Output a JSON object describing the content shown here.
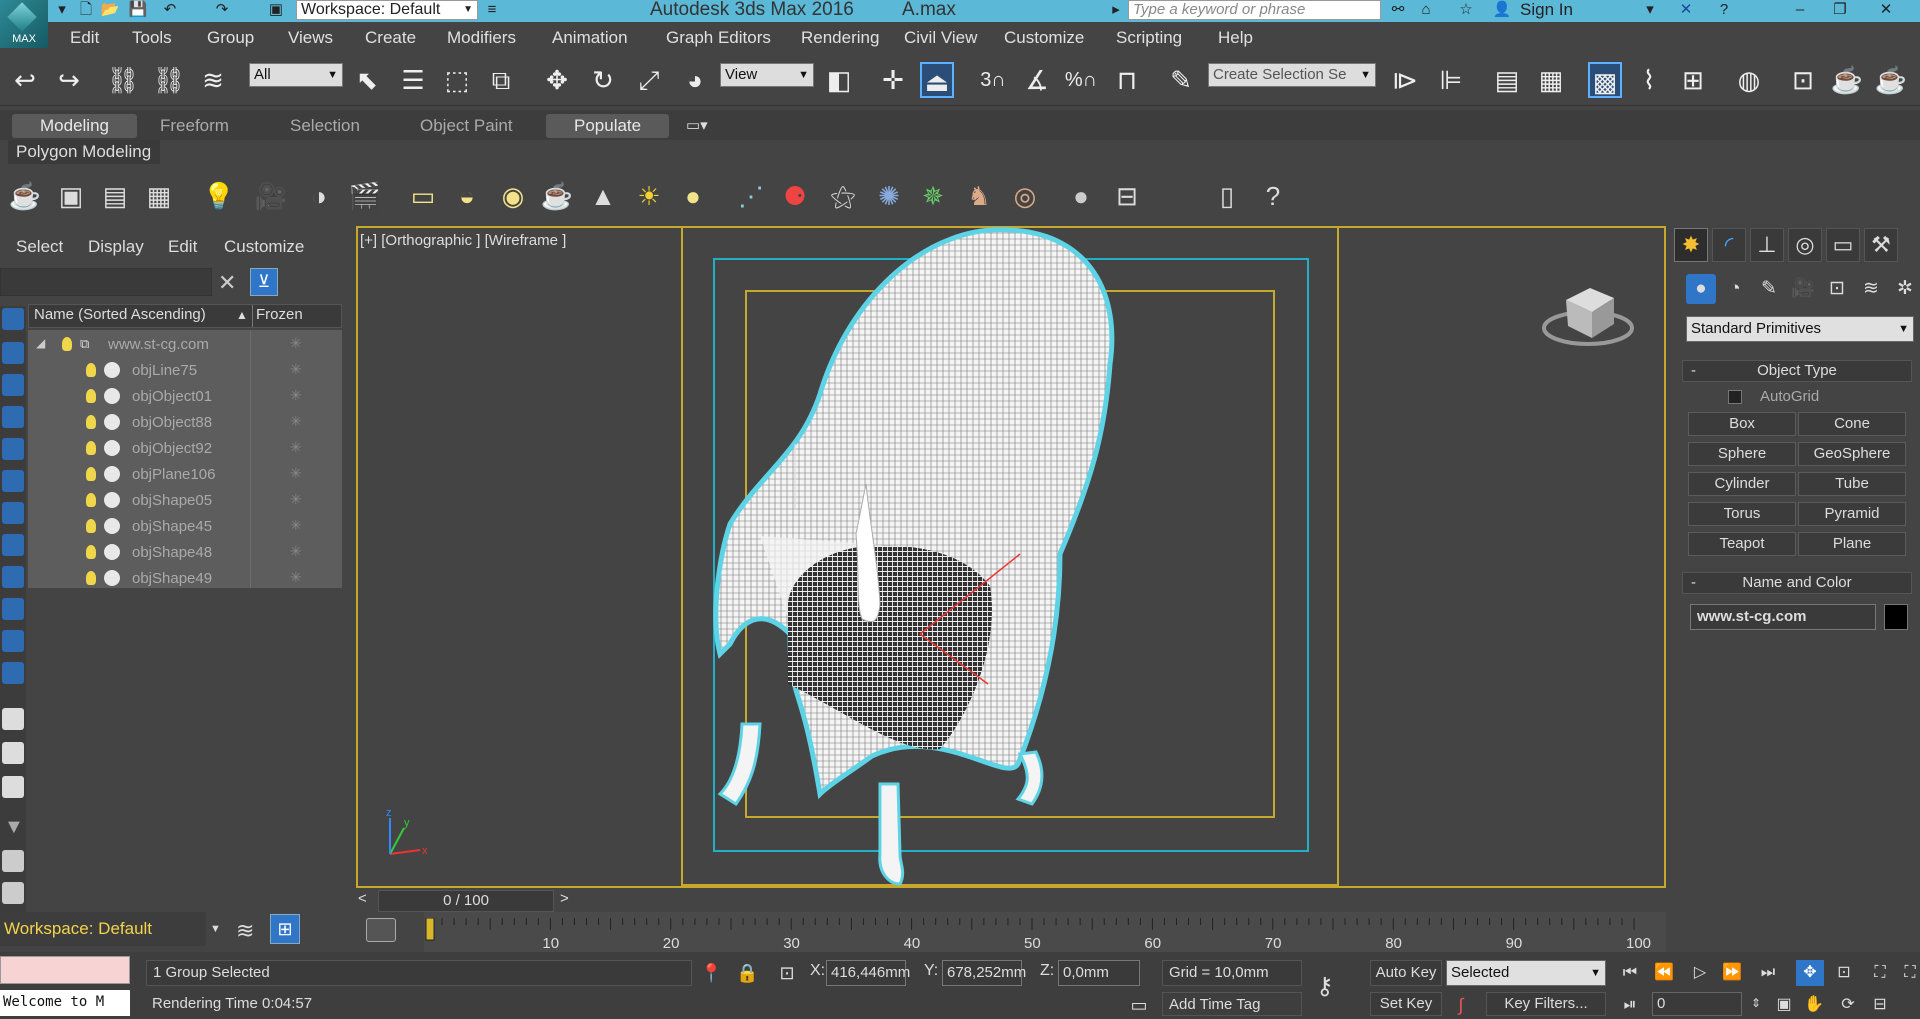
{
  "titlebar": {
    "workspace": "Workspace: Default",
    "app_title": "Autodesk 3ds Max 2016",
    "file_title": "A.max",
    "search_placeholder": "Type a keyword or phrase",
    "sign_in": "Sign In",
    "logo_label": "MAX"
  },
  "menu": [
    "Edit",
    "Tools",
    "Group",
    "Views",
    "Create",
    "Modifiers",
    "Animation",
    "Graph Editors",
    "Rendering",
    "Civil View",
    "Customize",
    "Scripting",
    "Help"
  ],
  "toolbar": {
    "selection_filter": "All",
    "ref_coord": "View",
    "selection_set": "Create Selection Se",
    "snap_3": "3",
    "snap_percent": "%"
  },
  "ribbon": {
    "tabs": [
      "Modeling",
      "Freeform",
      "Selection",
      "Object Paint",
      "Populate"
    ],
    "panel_label": "Polygon Modeling"
  },
  "explorer": {
    "menus": [
      "Select",
      "Display",
      "Edit",
      "Customize"
    ],
    "col_name": "Name (Sorted Ascending)",
    "col_frozen": "Frozen",
    "group_name": "www.st-cg.com",
    "objects": [
      "objLine75",
      "objObject01",
      "objObject88",
      "objObject92",
      "objPlane106",
      "objShape05",
      "objShape45",
      "objShape48",
      "objShape49"
    ],
    "workspace": "Workspace: Default"
  },
  "viewport": {
    "label": "[+] [Orthographic ] [Wireframe ]",
    "axis_x": "x",
    "axis_y": "y",
    "axis_z": "z"
  },
  "command_panel": {
    "primitive_type": "Standard Primitives",
    "object_type_title": "Object Type",
    "autogrid": "AutoGrid",
    "buttons": [
      "Box",
      "Cone",
      "Sphere",
      "GeoSphere",
      "Cylinder",
      "Tube",
      "Torus",
      "Pyramid",
      "Teapot",
      "Plane"
    ],
    "name_color_title": "Name and Color",
    "object_name": "www.st-cg.com",
    "object_color": "#000000"
  },
  "timeline": {
    "slider_value": "0 / 100",
    "current_frame": 0,
    "total_frames": 100,
    "ticks": [
      "10",
      "20",
      "30",
      "40",
      "50",
      "60",
      "70",
      "80",
      "90",
      "100"
    ]
  },
  "status": {
    "welcome": "Welcome to M",
    "selection": "1 Group Selected",
    "render_time": "Rendering Time  0:04:57",
    "x_label": "X:",
    "x_value": "416,446mm",
    "y_label": "Y:",
    "y_value": "678,252mm",
    "z_label": "Z:",
    "z_value": "0,0mm",
    "grid": "Grid = 10,0mm",
    "add_time_tag": "Add Time Tag",
    "auto_key": "Auto Key",
    "set_key": "Set Key",
    "key_mode": "Selected",
    "key_filters": "Key Filters...",
    "frame": "0"
  },
  "colors": {
    "title_bar": "#5bb8d6",
    "frame_gold": "#c8a82a",
    "frame_cyan": "#22b0c8",
    "workspace_text": "#f3d44a"
  }
}
